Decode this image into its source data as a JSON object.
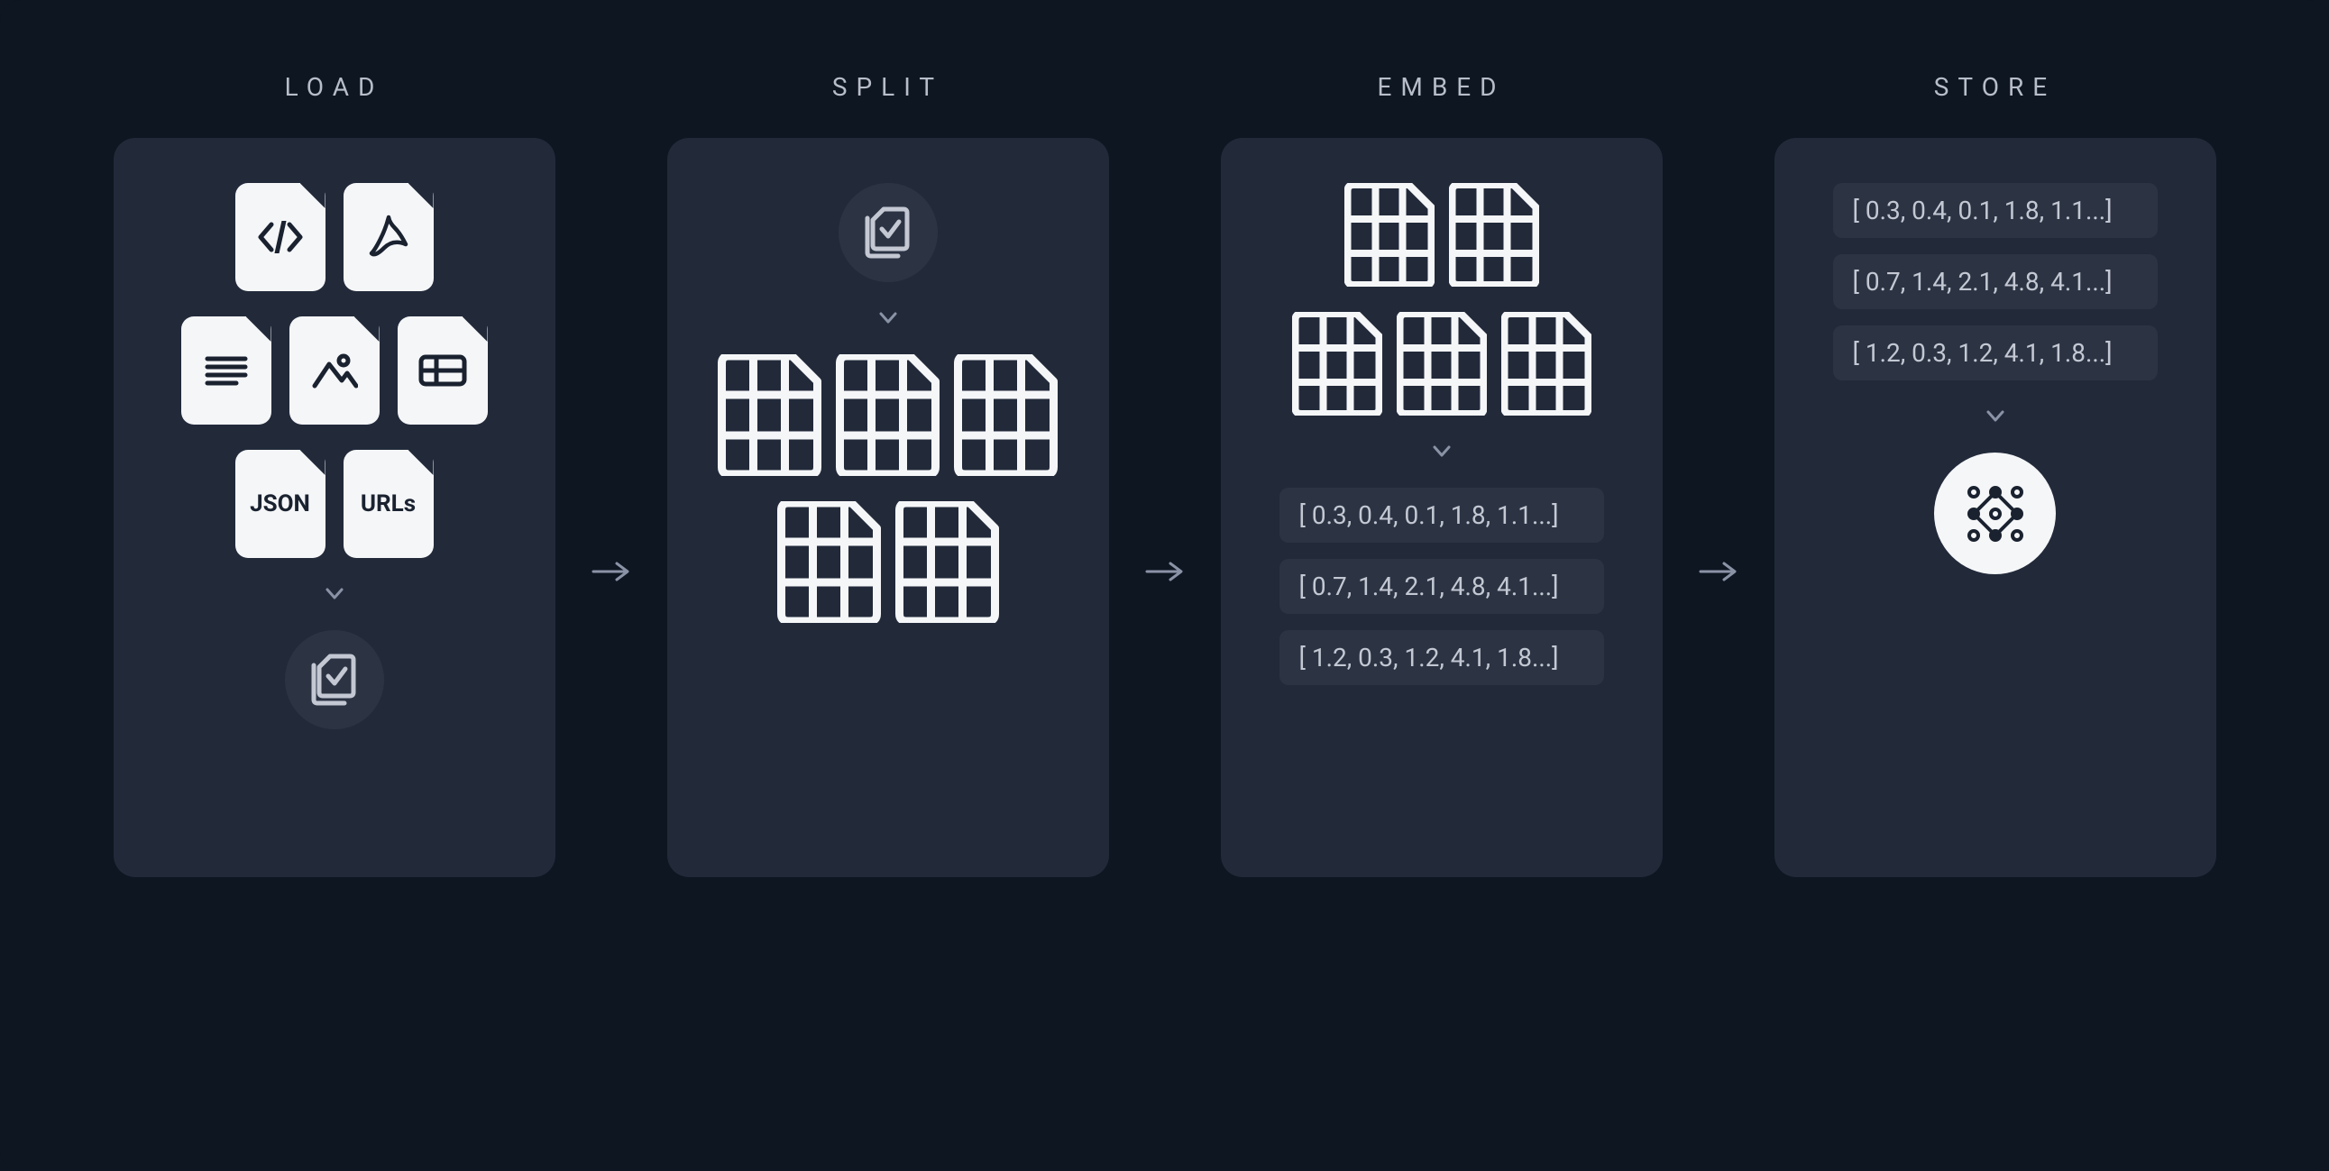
{
  "stages": {
    "load": {
      "label": "LOAD",
      "file_types": {
        "json": "JSON",
        "urls": "URLs"
      }
    },
    "split": {
      "label": "SPLIT"
    },
    "embed": {
      "label": "EMBED",
      "vectors": [
        "[ 0.3, 0.4, 0.1, 1.8, 1.1...]",
        "[ 0.7, 1.4, 2.1, 4.8, 4.1...]",
        "[ 1.2, 0.3, 1.2, 4.1, 1.8...]"
      ]
    },
    "store": {
      "label": "STORE",
      "vectors": [
        "[ 0.3, 0.4, 0.1, 1.8, 1.1...]",
        "[ 0.7, 1.4, 2.1, 4.8, 4.1...]",
        "[ 1.2, 0.3, 1.2, 4.1, 1.8...]"
      ]
    }
  }
}
